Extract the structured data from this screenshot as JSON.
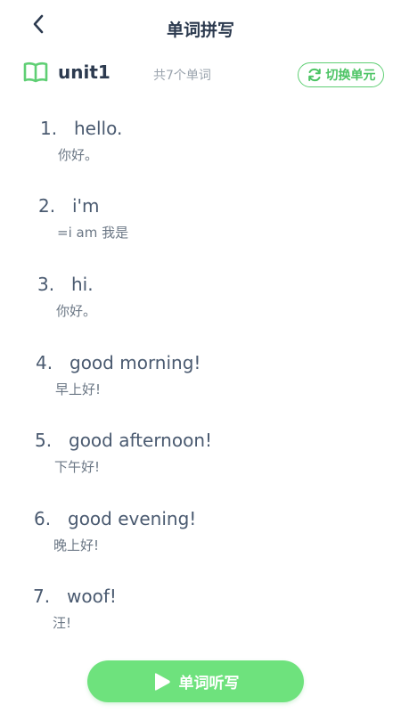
{
  "header": {
    "title": "单词拼写",
    "back_icon": "back-arrow-icon"
  },
  "unit": {
    "icon": "book-icon",
    "name": "unit1",
    "count_text": "共7个单词",
    "switch_icon": "refresh-icon",
    "switch_label": "切换单元"
  },
  "words": [
    {
      "num": "1.",
      "word": "hello.",
      "meaning": "你好。"
    },
    {
      "num": "2.",
      "word": "i'm",
      "meaning": "=i am 我是"
    },
    {
      "num": "3.",
      "word": "hi.",
      "meaning": "你好。"
    },
    {
      "num": "4.",
      "word": "good morning!",
      "meaning": "早上好!"
    },
    {
      "num": "5.",
      "word": "good afternoon!",
      "meaning": "下午好!"
    },
    {
      "num": "6.",
      "word": "good evening!",
      "meaning": "晚上好!"
    },
    {
      "num": "7.",
      "word": "woof!",
      "meaning": "汪!"
    }
  ],
  "footer": {
    "dictation_label": "单词听写",
    "dictation_icon": "play-icon"
  },
  "colors": {
    "accent_green": "#6ee27d",
    "title_text": "#2c3a4f",
    "word_text": "#4a5a70",
    "muted_text": "#9aa3ad"
  }
}
